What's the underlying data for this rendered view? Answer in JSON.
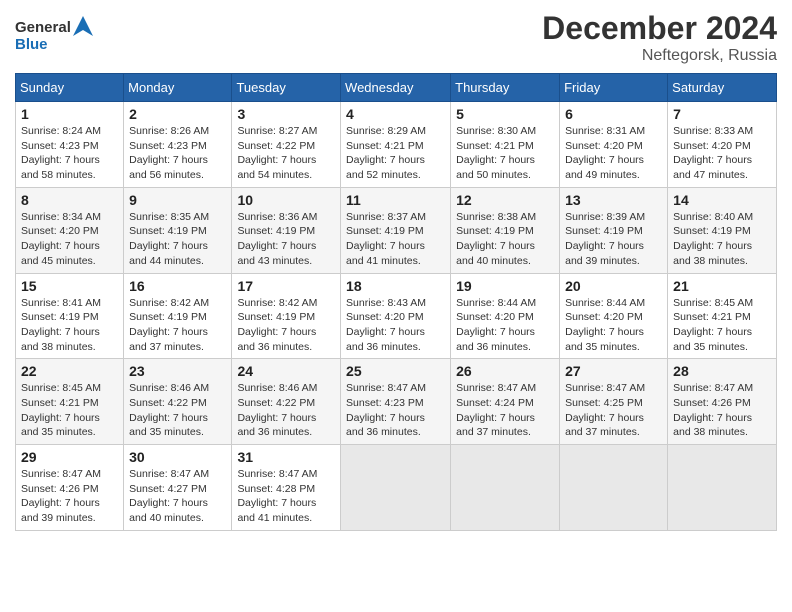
{
  "header": {
    "logo_line1": "General",
    "logo_line2": "Blue",
    "month_year": "December 2024",
    "location": "Neftegorsk, Russia"
  },
  "days_of_week": [
    "Sunday",
    "Monday",
    "Tuesday",
    "Wednesday",
    "Thursday",
    "Friday",
    "Saturday"
  ],
  "weeks": [
    [
      {
        "day": "1",
        "sunrise": "8:24 AM",
        "sunset": "4:23 PM",
        "daylight": "7 hours and 58 minutes."
      },
      {
        "day": "2",
        "sunrise": "8:26 AM",
        "sunset": "4:23 PM",
        "daylight": "7 hours and 56 minutes."
      },
      {
        "day": "3",
        "sunrise": "8:27 AM",
        "sunset": "4:22 PM",
        "daylight": "7 hours and 54 minutes."
      },
      {
        "day": "4",
        "sunrise": "8:29 AM",
        "sunset": "4:21 PM",
        "daylight": "7 hours and 52 minutes."
      },
      {
        "day": "5",
        "sunrise": "8:30 AM",
        "sunset": "4:21 PM",
        "daylight": "7 hours and 50 minutes."
      },
      {
        "day": "6",
        "sunrise": "8:31 AM",
        "sunset": "4:20 PM",
        "daylight": "7 hours and 49 minutes."
      },
      {
        "day": "7",
        "sunrise": "8:33 AM",
        "sunset": "4:20 PM",
        "daylight": "7 hours and 47 minutes."
      }
    ],
    [
      {
        "day": "8",
        "sunrise": "8:34 AM",
        "sunset": "4:20 PM",
        "daylight": "7 hours and 45 minutes."
      },
      {
        "day": "9",
        "sunrise": "8:35 AM",
        "sunset": "4:19 PM",
        "daylight": "7 hours and 44 minutes."
      },
      {
        "day": "10",
        "sunrise": "8:36 AM",
        "sunset": "4:19 PM",
        "daylight": "7 hours and 43 minutes."
      },
      {
        "day": "11",
        "sunrise": "8:37 AM",
        "sunset": "4:19 PM",
        "daylight": "7 hours and 41 minutes."
      },
      {
        "day": "12",
        "sunrise": "8:38 AM",
        "sunset": "4:19 PM",
        "daylight": "7 hours and 40 minutes."
      },
      {
        "day": "13",
        "sunrise": "8:39 AM",
        "sunset": "4:19 PM",
        "daylight": "7 hours and 39 minutes."
      },
      {
        "day": "14",
        "sunrise": "8:40 AM",
        "sunset": "4:19 PM",
        "daylight": "7 hours and 38 minutes."
      }
    ],
    [
      {
        "day": "15",
        "sunrise": "8:41 AM",
        "sunset": "4:19 PM",
        "daylight": "7 hours and 38 minutes."
      },
      {
        "day": "16",
        "sunrise": "8:42 AM",
        "sunset": "4:19 PM",
        "daylight": "7 hours and 37 minutes."
      },
      {
        "day": "17",
        "sunrise": "8:42 AM",
        "sunset": "4:19 PM",
        "daylight": "7 hours and 36 minutes."
      },
      {
        "day": "18",
        "sunrise": "8:43 AM",
        "sunset": "4:20 PM",
        "daylight": "7 hours and 36 minutes."
      },
      {
        "day": "19",
        "sunrise": "8:44 AM",
        "sunset": "4:20 PM",
        "daylight": "7 hours and 36 minutes."
      },
      {
        "day": "20",
        "sunrise": "8:44 AM",
        "sunset": "4:20 PM",
        "daylight": "7 hours and 35 minutes."
      },
      {
        "day": "21",
        "sunrise": "8:45 AM",
        "sunset": "4:21 PM",
        "daylight": "7 hours and 35 minutes."
      }
    ],
    [
      {
        "day": "22",
        "sunrise": "8:45 AM",
        "sunset": "4:21 PM",
        "daylight": "7 hours and 35 minutes."
      },
      {
        "day": "23",
        "sunrise": "8:46 AM",
        "sunset": "4:22 PM",
        "daylight": "7 hours and 35 minutes."
      },
      {
        "day": "24",
        "sunrise": "8:46 AM",
        "sunset": "4:22 PM",
        "daylight": "7 hours and 36 minutes."
      },
      {
        "day": "25",
        "sunrise": "8:47 AM",
        "sunset": "4:23 PM",
        "daylight": "7 hours and 36 minutes."
      },
      {
        "day": "26",
        "sunrise": "8:47 AM",
        "sunset": "4:24 PM",
        "daylight": "7 hours and 37 minutes."
      },
      {
        "day": "27",
        "sunrise": "8:47 AM",
        "sunset": "4:25 PM",
        "daylight": "7 hours and 37 minutes."
      },
      {
        "day": "28",
        "sunrise": "8:47 AM",
        "sunset": "4:26 PM",
        "daylight": "7 hours and 38 minutes."
      }
    ],
    [
      {
        "day": "29",
        "sunrise": "8:47 AM",
        "sunset": "4:26 PM",
        "daylight": "7 hours and 39 minutes."
      },
      {
        "day": "30",
        "sunrise": "8:47 AM",
        "sunset": "4:27 PM",
        "daylight": "7 hours and 40 minutes."
      },
      {
        "day": "31",
        "sunrise": "8:47 AM",
        "sunset": "4:28 PM",
        "daylight": "7 hours and 41 minutes."
      },
      null,
      null,
      null,
      null
    ]
  ],
  "labels": {
    "sunrise": "Sunrise:",
    "sunset": "Sunset:",
    "daylight": "Daylight:"
  }
}
